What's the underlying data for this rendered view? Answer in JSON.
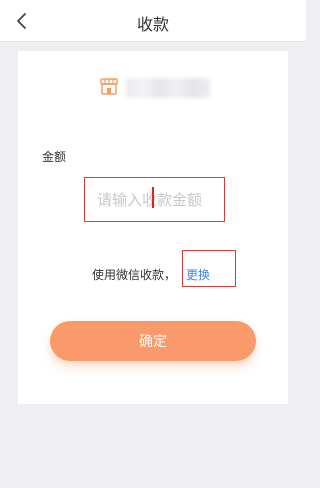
{
  "header": {
    "title": "收款",
    "back_icon": "chevron-left-icon"
  },
  "shop": {
    "icon": "shop-icon",
    "accent": "#f39a5e"
  },
  "form": {
    "amount_label": "金额",
    "amount_placeholder": "请输入收款金额",
    "amount_value": ""
  },
  "payment": {
    "text": "使用微信收款，",
    "change_label": "更换",
    "link_color": "#3a86e8"
  },
  "actions": {
    "confirm_label": "确定",
    "confirm_color": "#fa9a6a"
  }
}
